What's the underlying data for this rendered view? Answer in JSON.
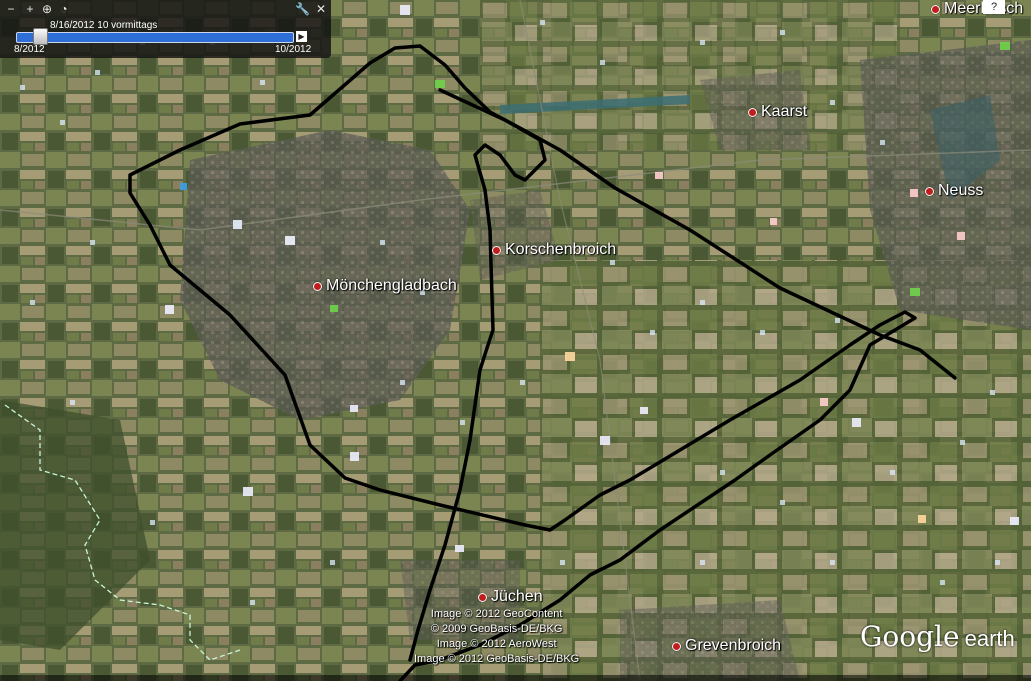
{
  "timeslider": {
    "current_time": "8/16/2012  10 vormittags",
    "start_label": "8/2012",
    "end_label": "10/2012",
    "progress": 0.06
  },
  "toolbar": {
    "zoom_out": "−",
    "zoom_in": "+",
    "settings": "🔧",
    "close": "✕"
  },
  "places": [
    {
      "name": "Mönchengladbach"
    },
    {
      "name": "Korschenbroich"
    },
    {
      "name": "Kaarst"
    },
    {
      "name": "Neuss"
    },
    {
      "name": "Jüchen"
    },
    {
      "name": "Grevenbroich"
    },
    {
      "name": "Meerbusch"
    }
  ],
  "credits": [
    "Image © 2012 GeoContent",
    "© 2009 GeoBasis-DE/BKG",
    "Image © 2012 AeroWest",
    "Image © 2012 GeoBasis-DE/BKG"
  ],
  "logo": {
    "word1": "Google",
    "word2": "earth"
  },
  "colors": {
    "track": "#000000",
    "slider": "#2d6fd6",
    "city_marker": "#c21d1d",
    "water": "#3c6f73"
  }
}
